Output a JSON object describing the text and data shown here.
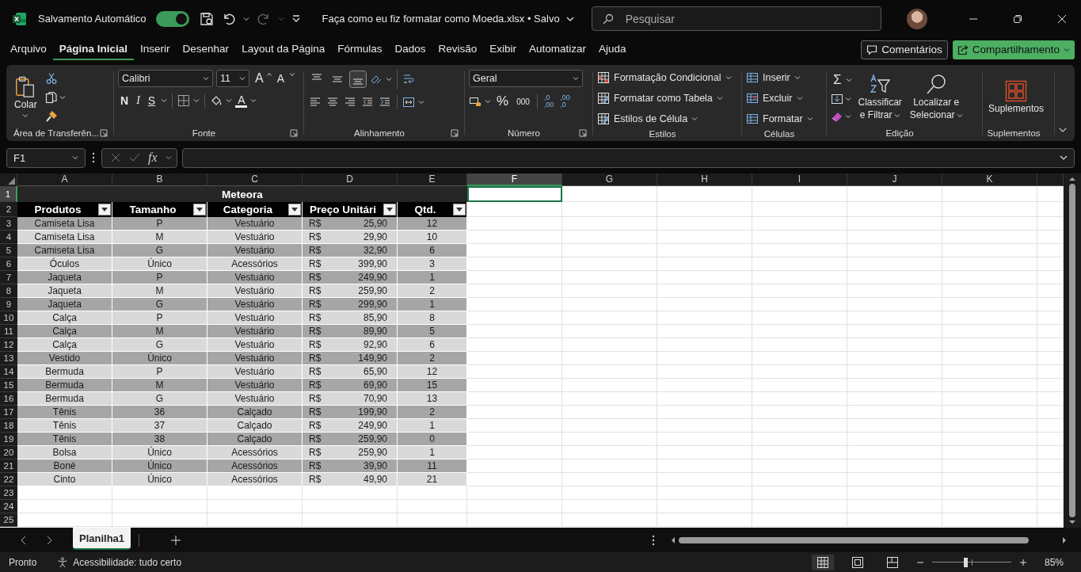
{
  "titlebar": {
    "autosave_label": "Salvamento Automático",
    "autosave_on": true,
    "redo_disabled": true,
    "filename": "Faça como eu fiz formatar como Moeda.xlsx",
    "separator": "•",
    "save_state": "Salvo",
    "search_placeholder": "Pesquisar"
  },
  "menu": {
    "tabs": [
      {
        "label": "Arquivo",
        "selected": false
      },
      {
        "label": "Página Inicial",
        "selected": true
      },
      {
        "label": "Inserir",
        "selected": false
      },
      {
        "label": "Desenhar",
        "selected": false
      },
      {
        "label": "Layout da Página",
        "selected": false
      },
      {
        "label": "Fórmulas",
        "selected": false
      },
      {
        "label": "Dados",
        "selected": false
      },
      {
        "label": "Revisão",
        "selected": false
      },
      {
        "label": "Exibir",
        "selected": false
      },
      {
        "label": "Automatizar",
        "selected": false
      },
      {
        "label": "Ajuda",
        "selected": false
      }
    ],
    "comments": "Comentários",
    "share": "Compartilhamento"
  },
  "ribbon": {
    "clipboard": {
      "label": "Área de Transferên...",
      "launcher": true,
      "paste": "Colar"
    },
    "font": {
      "label": "Fonte",
      "launcher": true,
      "family": "Calibri",
      "size": "11",
      "grow": "A",
      "shrink": "A",
      "styles": [
        "N",
        "I",
        "S"
      ],
      "font_color_button": "A"
    },
    "alignment": {
      "label": "Alinhamento",
      "launcher": true,
      "vertical": [
        {
          "selected": false
        },
        {
          "selected": false
        },
        {
          "selected": true
        }
      ]
    },
    "number": {
      "label": "Número",
      "launcher": true,
      "format": "Geral",
      "percent": "%",
      "thousands": "000",
      "decimals": [
        {
          "top": ",0",
          "bottom": ",00"
        },
        {
          "top": ",00",
          "bottom": ",0"
        }
      ]
    },
    "styles": {
      "label": "Estilos",
      "items": [
        "Formatação Condicional",
        "Formatar como Tabela",
        "Estilos de Célula"
      ]
    },
    "cells": {
      "label": "Células",
      "items": [
        "Inserir",
        "Excluir",
        "Formatar"
      ]
    },
    "editing": {
      "label": "Edição",
      "sigma": "Σ",
      "sort": [
        "Classificar",
        "e Filtrar"
      ],
      "find": [
        "Localizar e",
        "Selecionar"
      ]
    },
    "addins": {
      "label": "Suplementos",
      "button": "Suplementos"
    }
  },
  "formula_bar": {
    "name_box": "F1",
    "fx": "fx"
  },
  "sheet": {
    "columns": [
      {
        "label": "A",
        "selected": false
      },
      {
        "label": "B",
        "selected": false
      },
      {
        "label": "C",
        "selected": false
      },
      {
        "label": "D",
        "selected": false
      },
      {
        "label": "E",
        "selected": false
      },
      {
        "label": "F",
        "selected": true
      },
      {
        "label": "G",
        "selected": false
      },
      {
        "label": "H",
        "selected": false
      },
      {
        "label": "I",
        "selected": false
      },
      {
        "label": "J",
        "selected": false
      },
      {
        "label": "K",
        "selected": false
      }
    ],
    "rows": [
      {
        "label": "1",
        "selected": true
      },
      {
        "label": "2",
        "selected": false
      },
      {
        "label": "3",
        "selected": false
      },
      {
        "label": "4",
        "selected": false
      },
      {
        "label": "5",
        "selected": false
      },
      {
        "label": "6",
        "selected": false
      },
      {
        "label": "7",
        "selected": false
      },
      {
        "label": "8",
        "selected": false
      },
      {
        "label": "9",
        "selected": false
      },
      {
        "label": "10",
        "selected": false
      },
      {
        "label": "11",
        "selected": false
      },
      {
        "label": "12",
        "selected": false
      },
      {
        "label": "13",
        "selected": false
      },
      {
        "label": "14",
        "selected": false
      },
      {
        "label": "15",
        "selected": false
      },
      {
        "label": "16",
        "selected": false
      },
      {
        "label": "17",
        "selected": false
      },
      {
        "label": "18",
        "selected": false
      },
      {
        "label": "19",
        "selected": false
      },
      {
        "label": "20",
        "selected": false
      },
      {
        "label": "21",
        "selected": false
      },
      {
        "label": "22",
        "selected": false
      },
      {
        "label": "23",
        "selected": false
      },
      {
        "label": "24",
        "selected": false
      },
      {
        "label": "25",
        "selected": false
      }
    ],
    "table": {
      "title": "Meteora",
      "headers": [
        "Produtos",
        "Tamanho",
        "Categoria",
        "Preço Unitári",
        "Qtd."
      ],
      "rows": [
        [
          "Camiseta Lisa",
          "P",
          "Vestuário",
          {
            "currency": "R$",
            "amount": "25,90"
          },
          "12"
        ],
        [
          "Camiseta Lisa",
          "M",
          "Vestuário",
          {
            "currency": "R$",
            "amount": "29,90"
          },
          "10"
        ],
        [
          "Camiseta Lisa",
          "G",
          "Vestuário",
          {
            "currency": "R$",
            "amount": "32,90"
          },
          "6"
        ],
        [
          "Óculos",
          "Único",
          "Acessórios",
          {
            "currency": "R$",
            "amount": "399,90"
          },
          "3"
        ],
        [
          "Jaqueta",
          "P",
          "Vestuário",
          {
            "currency": "R$",
            "amount": "249,90"
          },
          "1"
        ],
        [
          "Jaqueta",
          "M",
          "Vestuário",
          {
            "currency": "R$",
            "amount": "259,90"
          },
          "2"
        ],
        [
          "Jaqueta",
          "G",
          "Vestuário",
          {
            "currency": "R$",
            "amount": "299,90"
          },
          "1"
        ],
        [
          "Calça",
          "P",
          "Vestuário",
          {
            "currency": "R$",
            "amount": "85,90"
          },
          "8"
        ],
        [
          "Calça",
          "M",
          "Vestuário",
          {
            "currency": "R$",
            "amount": "89,90"
          },
          "5"
        ],
        [
          "Calça",
          "G",
          "Vestuário",
          {
            "currency": "R$",
            "amount": "92,90"
          },
          "6"
        ],
        [
          "Vestido",
          "Único",
          "Vestuário",
          {
            "currency": "R$",
            "amount": "149,90"
          },
          "2"
        ],
        [
          "Bermuda",
          "P",
          "Vestuário",
          {
            "currency": "R$",
            "amount": "65,90"
          },
          "12"
        ],
        [
          "Bermuda",
          "M",
          "Vestuário",
          {
            "currency": "R$",
            "amount": "69,90"
          },
          "15"
        ],
        [
          "Bermuda",
          "G",
          "Vestuário",
          {
            "currency": "R$",
            "amount": "70,90"
          },
          "13"
        ],
        [
          "Tênis",
          "36",
          "Calçado",
          {
            "currency": "R$",
            "amount": "199,90"
          },
          "2"
        ],
        [
          "Tênis",
          "37",
          "Calçado",
          {
            "currency": "R$",
            "amount": "249,90"
          },
          "1"
        ],
        [
          "Tênis",
          "38",
          "Calçado",
          {
            "currency": "R$",
            "amount": "259,90"
          },
          "0"
        ],
        [
          "Bolsa",
          "Único",
          "Acessórios",
          {
            "currency": "R$",
            "amount": "259,90"
          },
          "1"
        ],
        [
          "Boné",
          "Único",
          "Acessórios",
          {
            "currency": "R$",
            "amount": "39,90"
          },
          "11"
        ],
        [
          "Cinto",
          "Único",
          "Acessórios",
          {
            "currency": "R$",
            "amount": "49,90"
          },
          "21"
        ]
      ]
    }
  },
  "sheet_tabs": [
    {
      "label": "Planilha1",
      "selected": true
    }
  ],
  "status_bar": {
    "status": "Pronto",
    "accessibility": "Acessibilidade: tudo certo",
    "views": [
      {
        "selected": true
      },
      {
        "selected": false
      },
      {
        "selected": false
      }
    ],
    "zoom_slider": {
      "level": 0.42
    },
    "zoom": "85%"
  }
}
